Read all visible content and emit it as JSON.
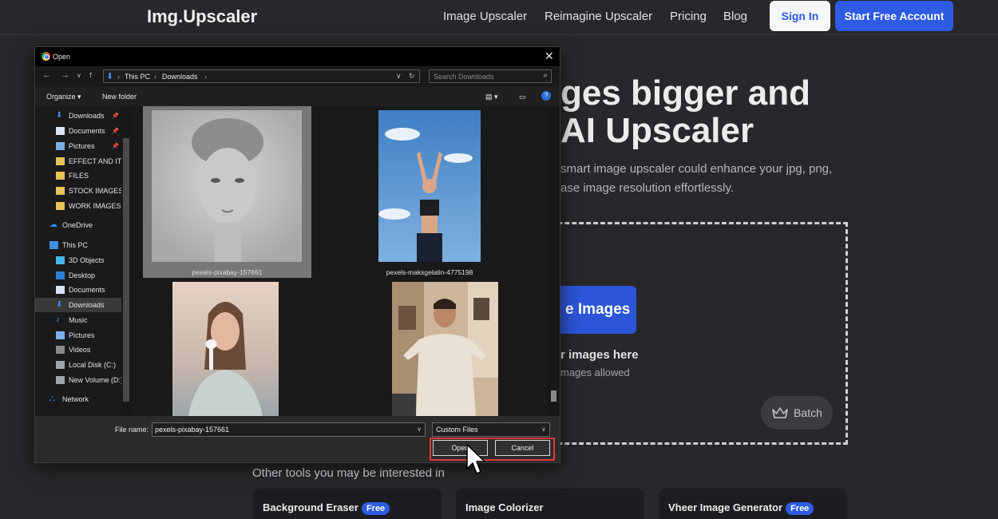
{
  "site": {
    "logo": "Img.Upscaler",
    "nav": [
      "Image Upscaler",
      "Reimagine Upscaler",
      "Pricing",
      "Blog"
    ],
    "sign_in": "Sign In",
    "start": "Start Free Account",
    "hero_line1": "ges bigger and",
    "hero_line2": "AI Upscaler",
    "sub_line1": "smart image upscaler could enhance your jpg, png,",
    "sub_line2": "ase image resolution effortlessly.",
    "upload_label": "e Images",
    "drop_text": "r images here",
    "drop_note": "mages allowed",
    "batch": "Batch",
    "other_title": "Other tools you may be interested in",
    "cards": [
      {
        "label": "Background Eraser",
        "badge": "Free"
      },
      {
        "label": "Image Colorizer",
        "badge": ""
      },
      {
        "label": "Vheer Image Generator",
        "badge": "Free"
      }
    ]
  },
  "dialog": {
    "title": "Open",
    "address": [
      "This PC",
      "Downloads"
    ],
    "search_placeholder": "Search Downloads",
    "toolbar": {
      "organize": "Organize ▾",
      "new_folder": "New folder"
    },
    "nav_items": [
      {
        "label": "Downloads",
        "icon": "download-icon",
        "pinned": true
      },
      {
        "label": "Documents",
        "icon": "documents-icon",
        "pinned": true
      },
      {
        "label": "Pictures",
        "icon": "pictures-icon",
        "pinned": true
      },
      {
        "label": "EFFECT AND ITEM",
        "icon": "folder-icon",
        "pinned": false
      },
      {
        "label": "FILES",
        "icon": "folder-icon",
        "pinned": false
      },
      {
        "label": "STOCK IMAGES",
        "icon": "folder-icon",
        "pinned": false
      },
      {
        "label": "WORK IMAGES",
        "icon": "folder-icon",
        "pinned": false
      },
      {
        "label": "OneDrive",
        "icon": "onedrive-icon",
        "pinned": false
      },
      {
        "label": "This PC",
        "icon": "pc-icon",
        "pinned": false
      },
      {
        "label": "3D Objects",
        "icon": "3d-objects-icon",
        "pinned": false
      },
      {
        "label": "Desktop",
        "icon": "desktop-icon",
        "pinned": false
      },
      {
        "label": "Documents",
        "icon": "documents-icon",
        "pinned": false
      },
      {
        "label": "Downloads",
        "icon": "download-icon",
        "pinned": false
      },
      {
        "label": "Music",
        "icon": "music-icon",
        "pinned": false
      },
      {
        "label": "Pictures",
        "icon": "pictures-icon",
        "pinned": false
      },
      {
        "label": "Videos",
        "icon": "videos-icon",
        "pinned": false
      },
      {
        "label": "Local Disk (C:)",
        "icon": "disk-icon",
        "pinned": false
      },
      {
        "label": "New Volume (D:)",
        "icon": "disk-icon",
        "pinned": false
      },
      {
        "label": "Network",
        "icon": "network-icon",
        "pinned": false
      }
    ],
    "files": [
      "pexels-pixabay-157661",
      "pexels-maksgelatin-4775198"
    ],
    "filename_label": "File name:",
    "filename_value": "pexels-pixabay-157661",
    "file_type": "Custom Files",
    "open_label": "Open",
    "cancel_label": "Cancel"
  }
}
